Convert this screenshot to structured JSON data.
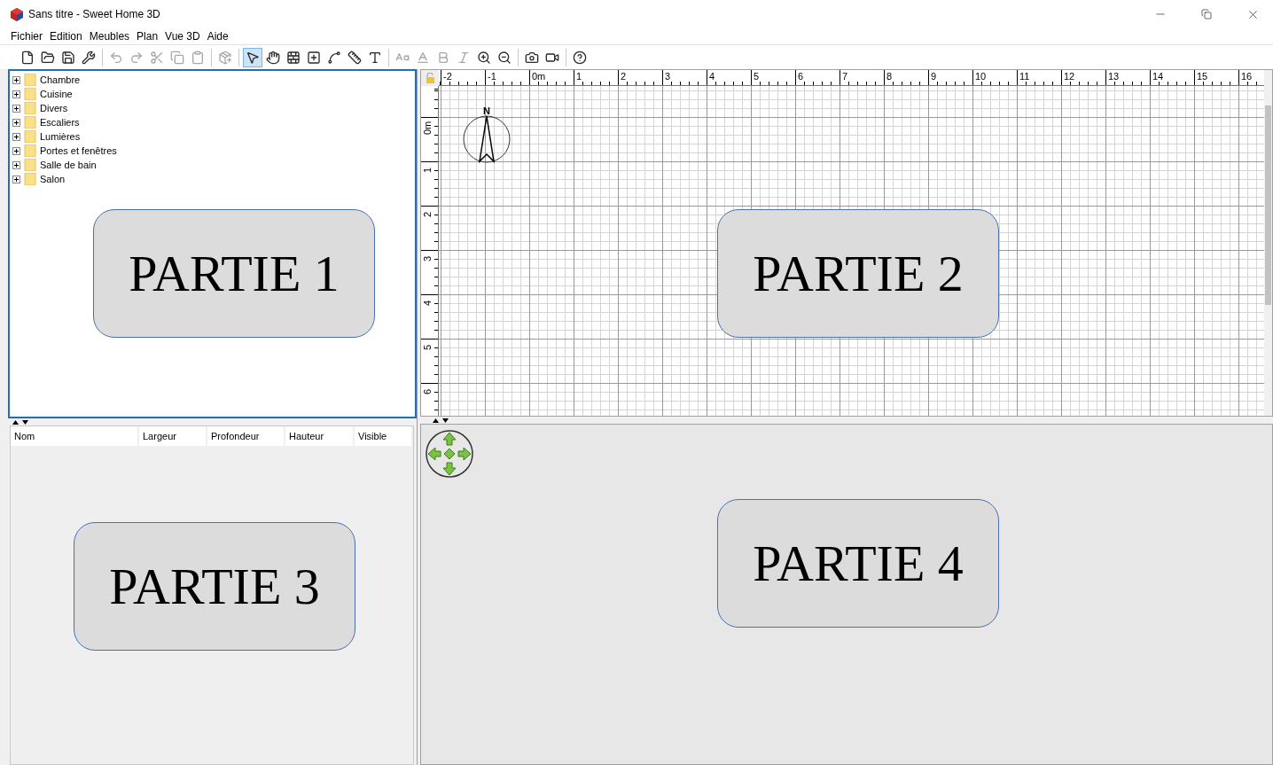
{
  "window": {
    "title": "Sans titre - Sweet Home 3D"
  },
  "menu": [
    "Fichier",
    "Edition",
    "Meubles",
    "Plan",
    "Vue 3D",
    "Aide"
  ],
  "toolbar": [
    {
      "disabled": false,
      "selected": false
    },
    {
      "disabled": false,
      "selected": false
    },
    {
      "disabled": false,
      "selected": false
    },
    {
      "disabled": false,
      "selected": false
    },
    {
      "disabled": true,
      "selected": false
    },
    {
      "disabled": true,
      "selected": false
    },
    {
      "disabled": true,
      "selected": false
    },
    {
      "disabled": true,
      "selected": false
    },
    {
      "disabled": true,
      "selected": false
    },
    {
      "disabled": true,
      "selected": false
    },
    {
      "disabled": false,
      "selected": true
    },
    {
      "disabled": false,
      "selected": false
    },
    {
      "disabled": false,
      "selected": false
    },
    {
      "disabled": false,
      "selected": false
    },
    {
      "disabled": false,
      "selected": false
    },
    {
      "disabled": false,
      "selected": false
    },
    {
      "disabled": false,
      "selected": false
    },
    {
      "disabled": true,
      "selected": false
    },
    {
      "disabled": true,
      "selected": false
    },
    {
      "disabled": true,
      "selected": false
    },
    {
      "disabled": true,
      "selected": false
    },
    {
      "disabled": false,
      "selected": false
    },
    {
      "disabled": false,
      "selected": false
    },
    {
      "disabled": false,
      "selected": false
    },
    {
      "disabled": false,
      "selected": false
    },
    {
      "disabled": false,
      "selected": false
    }
  ],
  "catalog": [
    {
      "label": "Chambre",
      "expanded": false
    },
    {
      "label": "Cuisine",
      "expanded": false
    },
    {
      "label": "Divers",
      "expanded": false
    },
    {
      "label": "Escaliers",
      "expanded": false
    },
    {
      "label": "Lumières",
      "expanded": false
    },
    {
      "label": "Portes et fenêtres",
      "expanded": false
    },
    {
      "label": "Salle de bain",
      "expanded": false
    },
    {
      "label": "Salon",
      "expanded": false
    }
  ],
  "furniture_table": {
    "columns": [
      "Nom",
      "Largeur",
      "Profondeur",
      "Hauteur",
      "Visible"
    ]
  },
  "plan": {
    "x_ruler": [
      "-2",
      "-1",
      "0m",
      "1",
      "2",
      "3",
      "4",
      "5",
      "6",
      "7",
      "8",
      "9",
      "10",
      "11",
      "12",
      "13",
      "14",
      "15",
      "16"
    ],
    "y_ruler": [
      "0m",
      "1",
      "2",
      "3",
      "4",
      "5",
      "6"
    ],
    "compass_label": "N"
  },
  "annotations": [
    "PARTIE 1",
    "PARTIE 2",
    "PARTIE 3",
    "PARTIE 4"
  ]
}
